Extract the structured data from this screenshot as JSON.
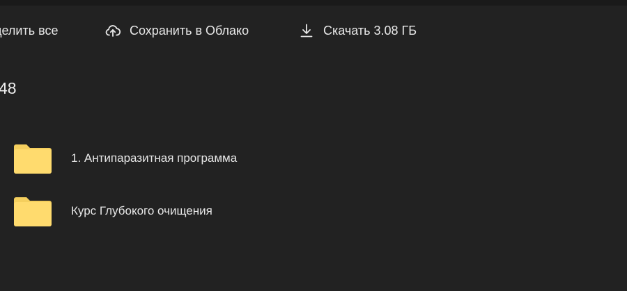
{
  "toolbar": {
    "select_all_label": "делить все",
    "save_label": "Сохранить в Облако",
    "download_label": "Скачать 3.08 ГБ"
  },
  "count_label": "48",
  "items": [
    {
      "name": "1. Антипаразитная программа",
      "icon": "folder-icon"
    },
    {
      "name": "Курс Глубокого очищения",
      "icon": "folder-icon"
    }
  ],
  "colors": {
    "background": "#222222",
    "topbar": "#1a1a1a",
    "folder": "#ffdb6e",
    "folder_tab": "#f5cf5e",
    "text": "#e6e6e6"
  }
}
